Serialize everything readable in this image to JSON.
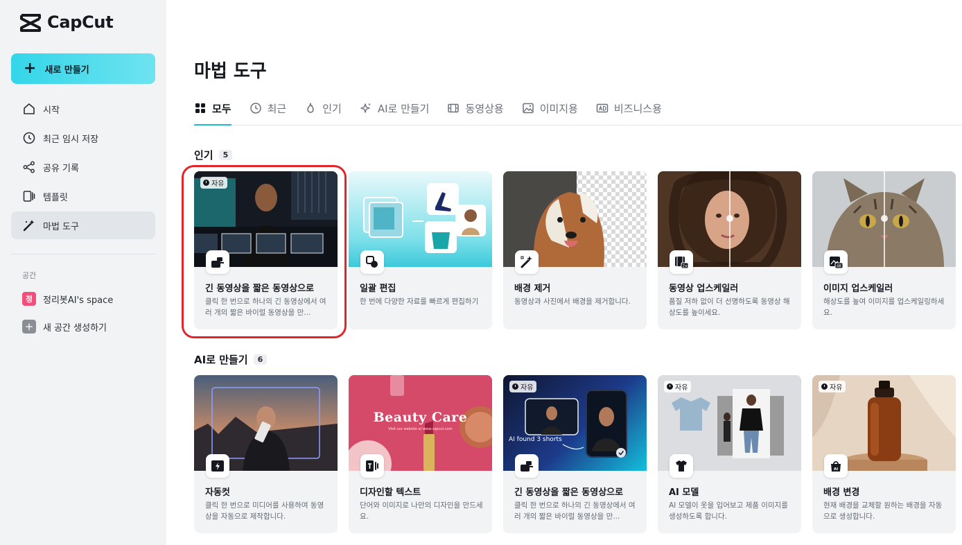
{
  "app": {
    "logo_text": "CapCut"
  },
  "sidebar": {
    "new_button": "새로 만들기",
    "items": [
      {
        "label": "시작",
        "icon": "home-icon"
      },
      {
        "label": "최근 임시 저장",
        "icon": "clock-icon"
      },
      {
        "label": "공유 기록",
        "icon": "share-icon"
      },
      {
        "label": "템플릿",
        "icon": "template-icon"
      },
      {
        "label": "마법 도구",
        "icon": "magic-wand-icon",
        "active": true
      }
    ],
    "space_section_label": "공간",
    "spaces": [
      {
        "badge": "정",
        "label": "정리봇AI's space"
      },
      {
        "badge": "+",
        "label": "새 공간 생성하기"
      }
    ]
  },
  "main": {
    "title": "마법 도구",
    "tabs": [
      {
        "label": "모두",
        "active": true
      },
      {
        "label": "최근"
      },
      {
        "label": "인기"
      },
      {
        "label": "AI로 만들기"
      },
      {
        "label": "동영상용"
      },
      {
        "label": "이미지용"
      },
      {
        "label": "비즈니스용"
      }
    ],
    "sections": [
      {
        "title": "인기",
        "count": "5",
        "cards": [
          {
            "title": "긴 동영상을 짧은 동영상으로",
            "desc": "클릭 한 번으로 하나의 긴 동영상에서 여러 개의 짧은 바이럴 동영상을 만...",
            "free": "자유"
          },
          {
            "title": "일괄 편집",
            "desc": "한 번에 다양한 자료를 빠르게 편집하기"
          },
          {
            "title": "배경 제거",
            "desc": "동영상과 사진에서 배경을 제거합니다."
          },
          {
            "title": "동영상 업스케일러",
            "desc": "품질 저하 없이 더 선명하도록 동영상 해상도를 높이세요."
          },
          {
            "title": "이미지 업스케일러",
            "desc": "해상도를 높여 이미지를 업스케일링하세요."
          }
        ]
      },
      {
        "title": "AI로 만들기",
        "count": "6",
        "cards": [
          {
            "title": "자동컷",
            "desc": "클릭 한 번으로 미디어를 사용하여 동영상을 자동으로 제작합니다."
          },
          {
            "title": "디자인할 텍스트",
            "desc": "단어와 이미지로 나만의 디자인을 만드세요.",
            "overlay_text": "Beauty Care",
            "overlay_sub": "Visit our website at www.capcut.com"
          },
          {
            "title": "긴 동영상을 짧은 동영상으로",
            "desc": "클릭 한 번으로 하나의 긴 동영상에서 여러 개의 짧은 바이럴 동영상을 만...",
            "free": "자유",
            "overlay_text": "AI found 3 shorts"
          },
          {
            "title": "AI 모델",
            "desc": "AI 모델이 옷을 입어보고 제품 이미지를 생성하도록 합니다.",
            "free": "자유"
          },
          {
            "title": "배경 변경",
            "desc": "현재 배경을 교체할 원하는 배경을 자동으로 생성합니다.",
            "free": "자유"
          }
        ]
      }
    ]
  },
  "colors": {
    "accent": "#1fbcd0",
    "new_button": "#34d6ea",
    "highlight": "#e0262a"
  }
}
